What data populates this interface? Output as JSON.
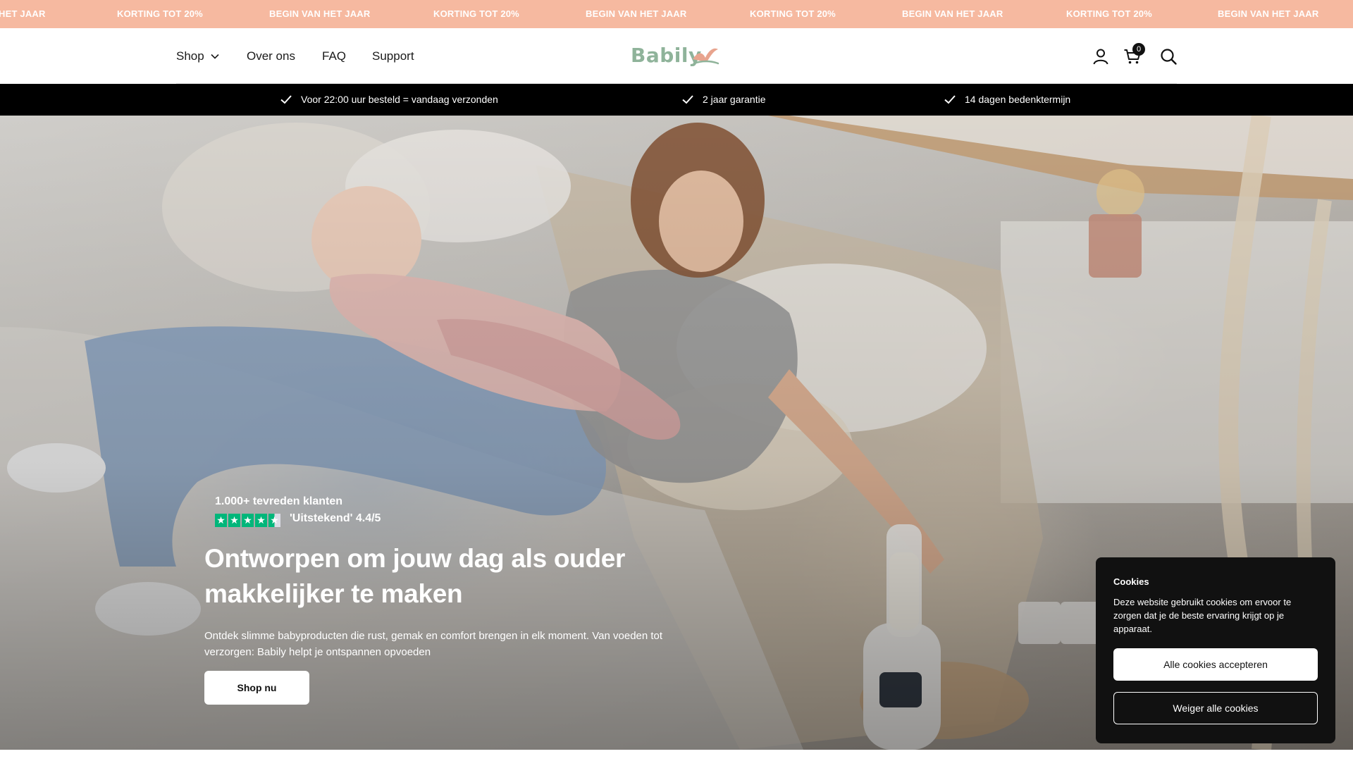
{
  "announcement": {
    "items": [
      "HET JAAR",
      "KORTING TOT 20%",
      "BEGIN VAN HET JAAR",
      "KORTING TOT 20%",
      "BEGIN VAN HET JAAR",
      "KORTING TOT 20%",
      "BEGIN VAN HET JAAR",
      "KORTING TOT 20%",
      "BEGIN VAN HET JAAR"
    ]
  },
  "nav": {
    "shop": "Shop",
    "about": "Over ons",
    "faq": "FAQ",
    "support": "Support"
  },
  "logo": {
    "text": "Babily"
  },
  "cart": {
    "count": "0"
  },
  "usp": {
    "items": [
      "Voor 22:00 uur besteld = vandaag verzonden",
      "2 jaar garantie",
      "14 dagen bedenktermijn"
    ]
  },
  "hero": {
    "rating_title": "1.000+ tevreden klanten",
    "rating_score": "'Uitstekend' 4.4/5",
    "rating_value": 4.4,
    "rating_max": 5,
    "title": "Ontworpen om jouw dag als ouder makkelijker te maken",
    "subtitle": "Ontdek slimme babyproducten die rust, gemak en comfort brengen in elk moment. Van voeden tot verzorgen: Babily helpt je ontspannen opvoeden",
    "cta": "Shop nu"
  },
  "cookies": {
    "title": "Cookies",
    "text": "Deze website gebruikt cookies om ervoor te zorgen dat je de beste ervaring krijgt op je apparaat.",
    "accept": "Alle cookies accepteren",
    "reject": "Weiger alle cookies"
  },
  "colors": {
    "announcement_bg": "#f6b9a0",
    "usp_bg": "#000000",
    "logo_green": "#8fb39a",
    "trustpilot_green": "#00b67a",
    "cookie_bg": "#111111"
  },
  "icons": {
    "nav": [
      "chevron-down-icon"
    ],
    "header": [
      "account-icon",
      "cart-icon",
      "search-icon"
    ],
    "usp": [
      "check-icon"
    ],
    "rating": [
      "star-icon"
    ]
  }
}
